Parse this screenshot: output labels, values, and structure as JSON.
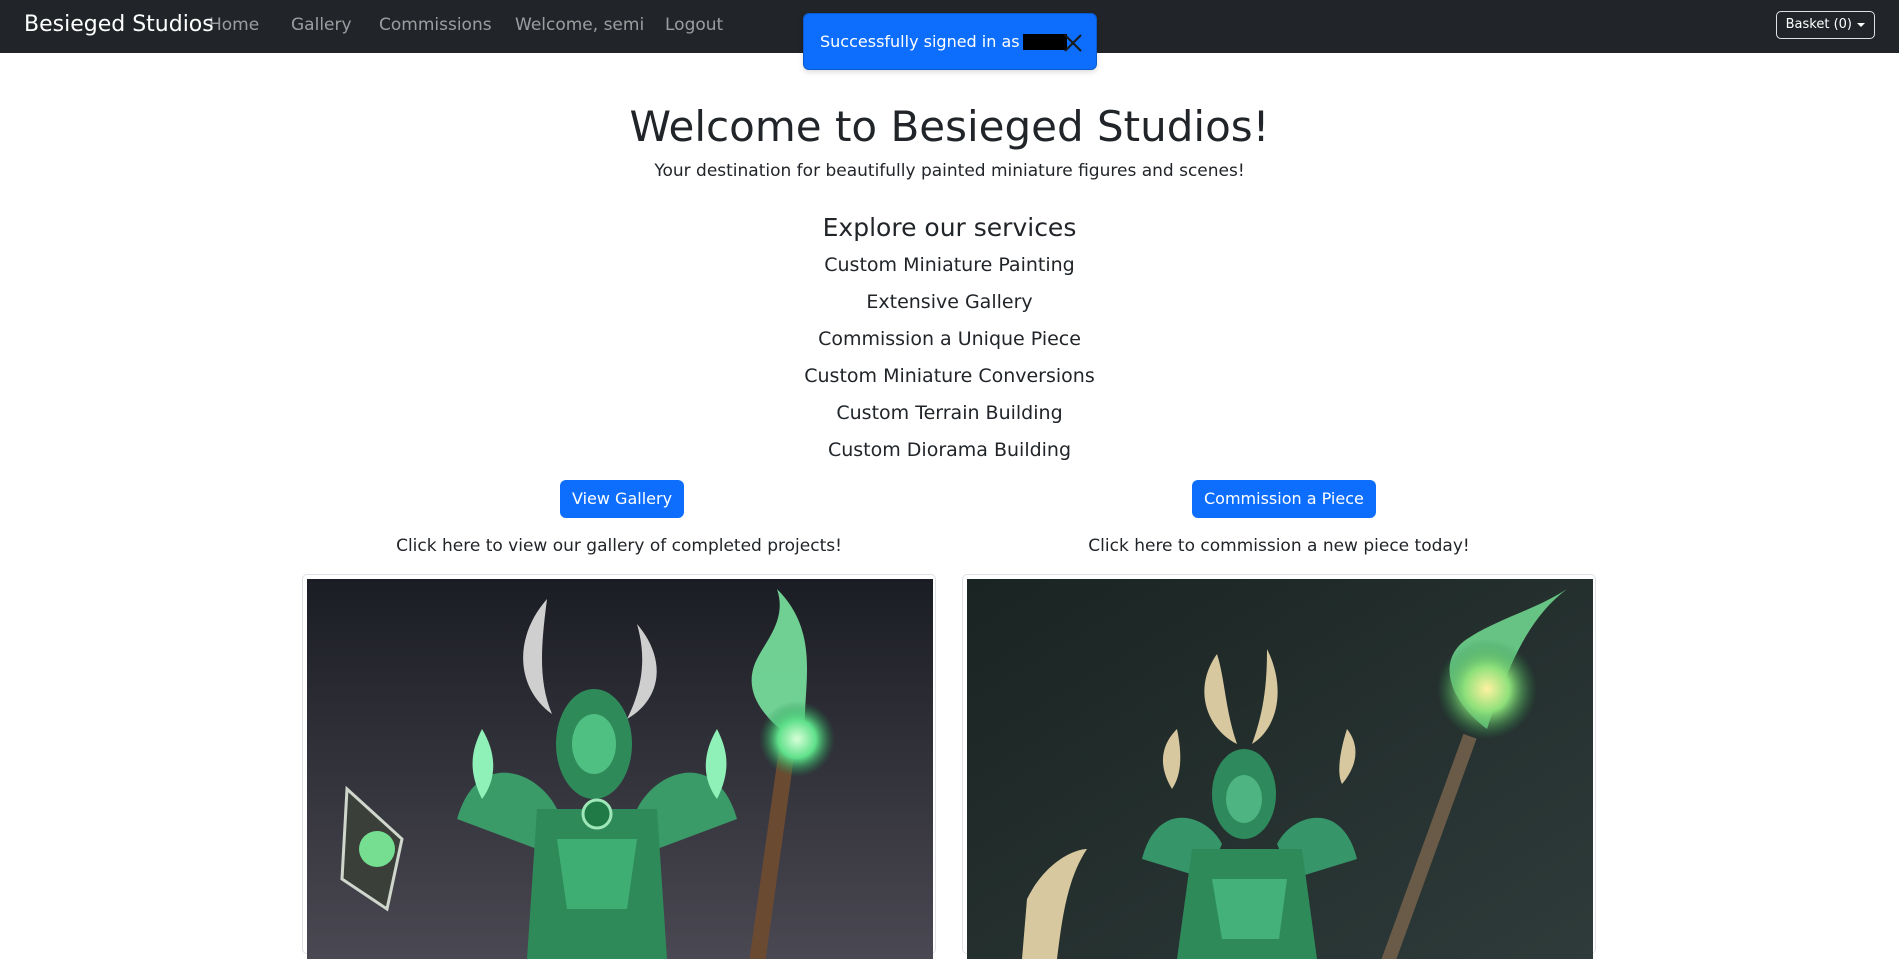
{
  "navbar": {
    "brand": "Besieged Studios",
    "links": [
      "Home",
      "Gallery",
      "Commissions",
      "Welcome, semi",
      "Logout"
    ],
    "basket_label": "Basket (0)"
  },
  "toast": {
    "message": "Successfully signed in as"
  },
  "hero": {
    "title": "Welcome to Besieged Studios!",
    "subtitle": "Your destination for beautifully painted miniature figures and scenes!"
  },
  "services": {
    "title": "Explore our services",
    "items": [
      "Custom Miniature Painting",
      "Extensive Gallery",
      "Commission a Unique Piece",
      "Custom Miniature Conversions",
      "Custom Terrain Building",
      "Custom Diorama Building"
    ]
  },
  "cta": {
    "gallery_button": "View Gallery",
    "gallery_text": "Click here to view our gallery of completed projects!",
    "commission_button": "Commission a Piece",
    "commission_text": "Click here to commission a new piece today!"
  },
  "colors": {
    "navbar": "#212529",
    "primary": "#0d6efd",
    "text": "#212529"
  },
  "icons": [
    "close-icon",
    "caret-down-icon"
  ]
}
